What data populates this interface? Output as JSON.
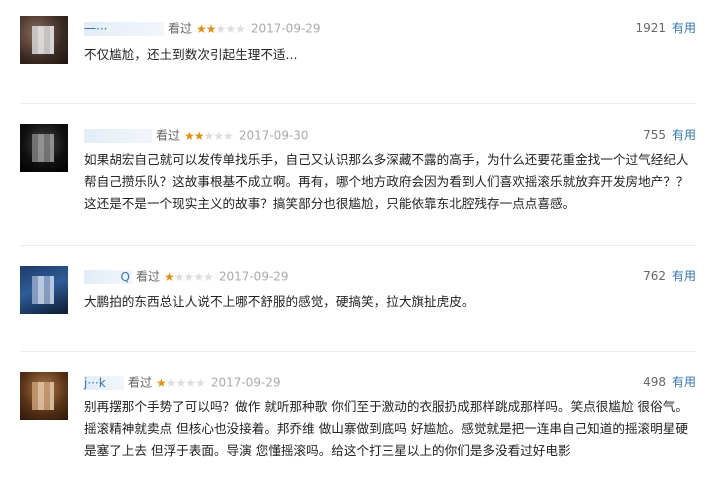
{
  "reviews": [
    {
      "user": "一···",
      "watched": "看过",
      "stars_on": 2,
      "stars_off": 3,
      "date": "2017-09-29",
      "votes": "1921",
      "useful": "有用",
      "text": "不仅尴尬，还土到数次引起生理不适..."
    },
    {
      "user": "",
      "watched": "看过",
      "stars_on": 2,
      "stars_off": 3,
      "date": "2017-09-30",
      "votes": "755",
      "useful": "有用",
      "text": "如果胡宏自己就可以发传单找乐手，自己又认识那么多深藏不露的高手，为什么还要花重金找一个过气经纪人帮自己攒乐队？这故事根基不成立啊。再有，哪个地方政府会因为看到人们喜欢摇滚乐就放弃开发房地产？？这还是不是一个现实主义的故事？搞笑部分也很尴尬，只能依靠东北腔残存一点点喜感。"
    },
    {
      "user": "Q",
      "watched": "看过",
      "stars_on": 1,
      "stars_off": 4,
      "date": "2017-09-29",
      "votes": "762",
      "useful": "有用",
      "text": "大鹏拍的东西总让人说不上哪不舒服的感觉，硬搞笑，拉大旗扯虎皮。"
    },
    {
      "user": "j···k",
      "watched": "看过",
      "stars_on": 1,
      "stars_off": 4,
      "date": "2017-09-29",
      "votes": "498",
      "useful": "有用",
      "text": "别再摆那个手势了可以吗？做作 就听那种歌 你们至于激动的衣服扔成那样跳成那样吗。笑点很尴尬 很俗气。摇滚精神就卖点 但核心也没接着。邦乔维 做山寨做到底吗 好尴尬。感觉就是把一连串自己知道的摇滚明星硬是塞了上去 但浮于表面。导演 您懂摇滚吗。给这个打三星以上的你们是多没看过好电影"
    }
  ]
}
